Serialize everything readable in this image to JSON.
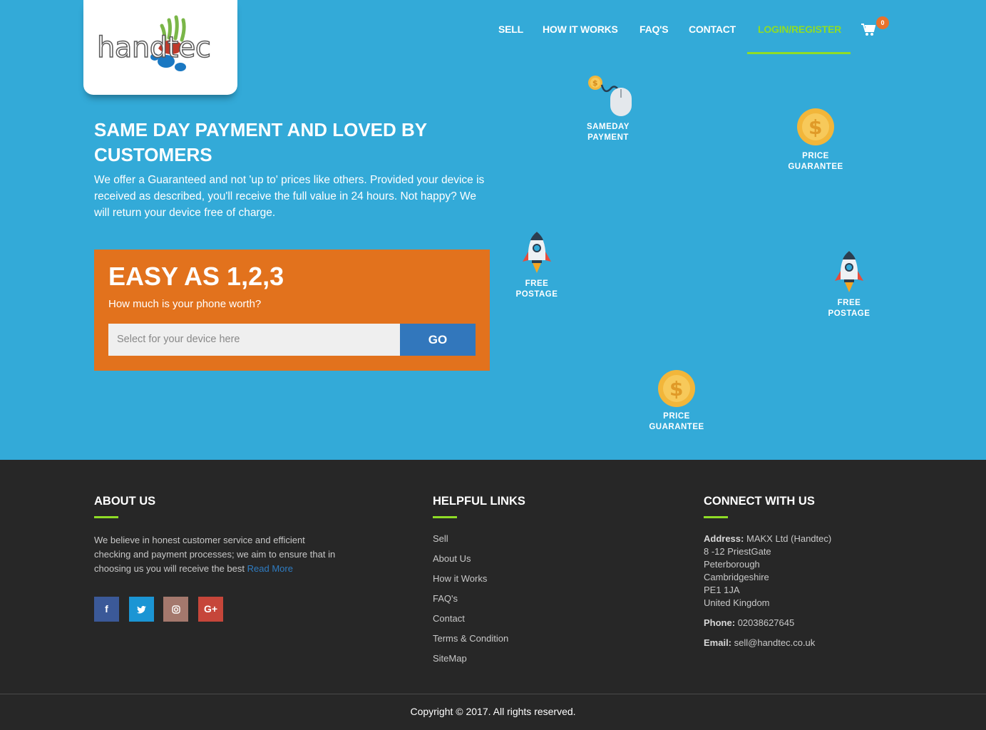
{
  "logo": {
    "text": "handtec"
  },
  "nav": {
    "items": [
      {
        "label": "SELL"
      },
      {
        "label": "HOW IT WORKS"
      },
      {
        "label": "FAQ'S"
      },
      {
        "label": "CONTACT"
      },
      {
        "label": "LOGIN/REGISTER",
        "active": true
      }
    ],
    "cart_count": "0"
  },
  "hero": {
    "title": "SAME DAY PAYMENT AND LOVED BY CUSTOMERS",
    "description": "We offer a Guaranteed and not 'up to' prices like others. Provided your device is received as described, you'll receive the full value in 24 hours. Not happy? We will return your device free of charge."
  },
  "easy": {
    "title": "EASY AS 1,2,3",
    "subtitle": "How much is your phone worth?",
    "input_placeholder": "Select for your device here",
    "button_label": "GO"
  },
  "features": [
    {
      "icon": "mouse-coin-icon",
      "line1": "SAMEDAY",
      "line2": "PAYMENT"
    },
    {
      "icon": "dollar-coin-icon",
      "line1": "PRICE",
      "line2": "GUARANTEE"
    },
    {
      "icon": "rocket-icon",
      "line1": "FREE",
      "line2": "POSTAGE"
    },
    {
      "icon": "rocket-icon",
      "line1": "FREE",
      "line2": "POSTAGE"
    },
    {
      "icon": "dollar-coin-icon",
      "line1": "PRICE",
      "line2": "GUARANTEE"
    }
  ],
  "footer": {
    "about": {
      "heading": "ABOUT US",
      "text": "We believe in honest customer service and efficient checking and payment processes; we aim to ensure that in choosing us you will receive the best",
      "read_more": "Read More"
    },
    "social": [
      {
        "icon": "facebook-icon",
        "glyph": "f",
        "color": "#3b5998"
      },
      {
        "icon": "twitter-icon",
        "glyph": "t",
        "color": "#1b95d4"
      },
      {
        "icon": "instagram-icon",
        "glyph": "◎",
        "color": "#a4786d"
      },
      {
        "icon": "google-plus-icon",
        "glyph": "G+",
        "color": "#c6463a"
      }
    ],
    "links": {
      "heading": "HELPFUL LINKS",
      "items": [
        "Sell",
        "About Us",
        "How it Works",
        "FAQ's",
        "Contact",
        "Terms & Condition",
        "SiteMap"
      ]
    },
    "connect": {
      "heading": "CONNECT WITH US",
      "address_label": "Address:",
      "address_lines": [
        "MAKX Ltd (Handtec)",
        "8 -12 PriestGate",
        "Peterborough",
        "Cambridgeshire",
        "PE1 1JA",
        "United Kingdom"
      ],
      "phone_label": "Phone:",
      "phone": "02038627645",
      "email_label": "Email:",
      "email": "sell@handtec.co.uk"
    },
    "copyright": "Copyright © 2017. All rights reserved."
  },
  "colors": {
    "hero_bg": "#33aad8",
    "accent_green": "#8fdc26",
    "orange": "#e2721d",
    "go_blue": "#3277bc",
    "footer_bg": "#272727"
  }
}
